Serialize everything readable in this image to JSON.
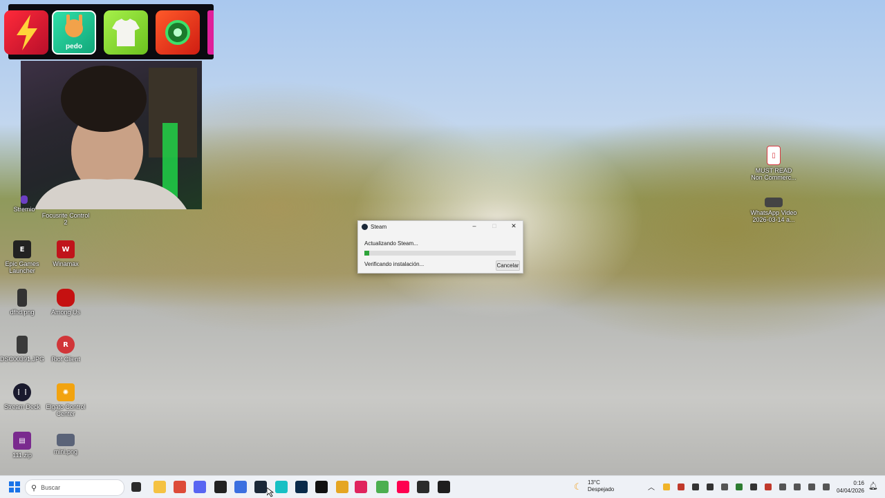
{
  "overlay": {
    "tiles": [
      {
        "icon": "lightning-bolt-icon",
        "color": "#e8213b"
      },
      {
        "icon": "rock-hand-icon",
        "label": "pedo",
        "color": "#22c59a"
      },
      {
        "icon": "tshirt-icon",
        "color": "#8fe33a"
      },
      {
        "icon": "green-orb-icon",
        "color": "#e8361e"
      }
    ]
  },
  "desktop_icons": [
    {
      "label": "Stremio",
      "icon": "stremio-icon",
      "color": "#6c3fc4"
    },
    {
      "label": "Focusrite Control 2",
      "icon": "focusrite-icon",
      "color": "#c8202d"
    },
    {
      "label": "Epic Games Launcher",
      "icon": "epic-games-icon",
      "color": "#222222"
    },
    {
      "label": "Winamax",
      "icon": "winamax-icon",
      "color": "#c0141b"
    },
    {
      "label": "dfhd.png",
      "icon": "image-file-icon",
      "color": "#333333"
    },
    {
      "label": "Among Us",
      "icon": "among-us-icon",
      "color": "#c51111"
    },
    {
      "label": "DSC00391.JPG",
      "icon": "photo-file-icon",
      "color": "#3a3a3a"
    },
    {
      "label": "Riot Client",
      "icon": "riot-client-icon",
      "color": "#d13639"
    },
    {
      "label": "Stream Deck",
      "icon": "stream-deck-icon",
      "color": "#1a1a2e"
    },
    {
      "label": "Elgato Control Center",
      "icon": "elgato-icon",
      "color": "#f2a30f"
    },
    {
      "label": "111.zip",
      "icon": "winrar-icon",
      "color": "#7a2a8e"
    },
    {
      "label": "mini.png",
      "icon": "png-file-icon",
      "color": "#5a6378"
    },
    {
      "label": "MUST READ Non Commerc...",
      "icon": "pdf-file-icon",
      "color": "#d7373f"
    },
    {
      "label": "WhatsApp Video 2026-03-14 a...",
      "icon": "video-file-icon",
      "color": "#444444"
    }
  ],
  "steam_dialog": {
    "title": "Steam",
    "status": "Actualizando Steam...",
    "progress": 0.03,
    "detail": "Verificando instalación...",
    "cancel_label": "Cancelar"
  },
  "taskbar": {
    "search_placeholder": "Buscar",
    "apps": [
      {
        "icon": "file-explorer-icon",
        "color": "#f5c242"
      },
      {
        "icon": "chrome-icon",
        "color": "#dd4b39"
      },
      {
        "icon": "discord-icon",
        "color": "#5865f2"
      },
      {
        "icon": "epic-games-icon",
        "color": "#222222"
      },
      {
        "icon": "arc-icon",
        "color": "#3b6fe0"
      },
      {
        "icon": "steam-icon",
        "color": "#1b2838"
      },
      {
        "icon": "capcut-icon",
        "color": "#16c0c4"
      },
      {
        "icon": "photoshop-icon",
        "color": "#0a2a4a"
      },
      {
        "icon": "capcut-alt-icon",
        "color": "#111111"
      },
      {
        "icon": "coin-icon",
        "color": "#e5a623"
      },
      {
        "icon": "typora-icon",
        "color": "#e0245e"
      },
      {
        "icon": "game-icon",
        "color": "#4caf50"
      },
      {
        "icon": "tiktok-icon",
        "color": "#ff0050"
      },
      {
        "icon": "obs-icon",
        "color": "#2b2b2b"
      },
      {
        "icon": "terminal-icon",
        "color": "#1e1e1e"
      }
    ],
    "weather": {
      "temp": "13°C",
      "condition": "Despejado"
    },
    "clock": {
      "time": "0:16",
      "date": "04/04/2026"
    }
  }
}
